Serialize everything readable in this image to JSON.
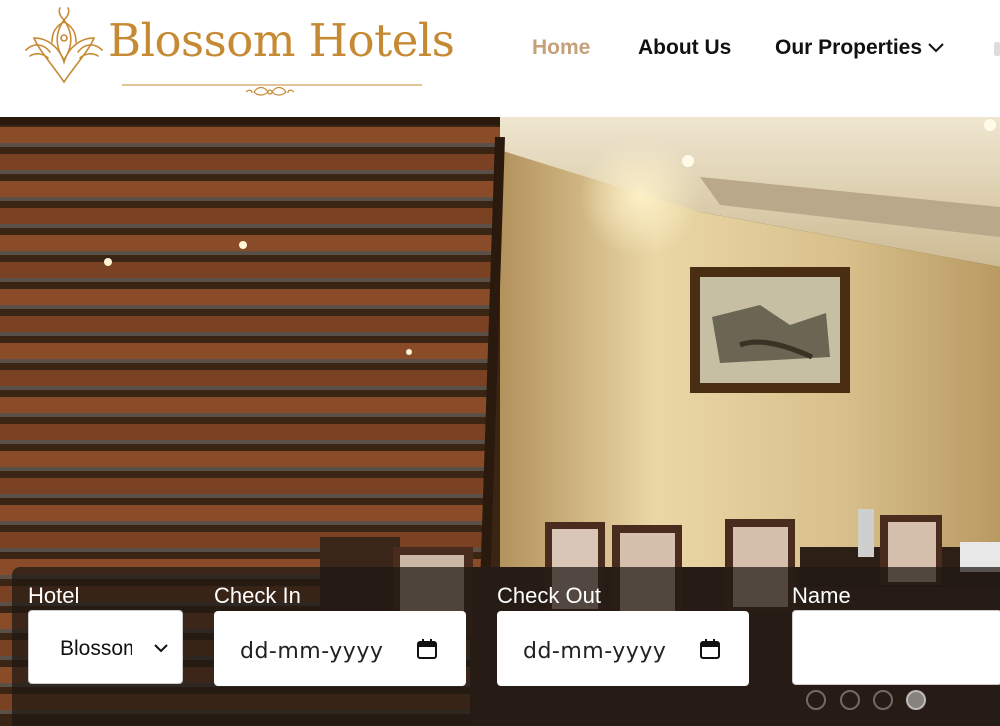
{
  "brand": {
    "name": "Blossom Hotels",
    "color": "#c78a34"
  },
  "nav": {
    "items": [
      {
        "label": "Home",
        "active": true
      },
      {
        "label": "About Us",
        "active": false
      },
      {
        "label": "Our Properties",
        "active": false,
        "icon": "chevron-down-icon"
      }
    ],
    "active_color": "#c4a178"
  },
  "booking": {
    "hotel": {
      "label": "Hotel",
      "value": "Blossom"
    },
    "check_in": {
      "label": "Check In",
      "value": "dd-mm-yyyy",
      "icon": "calendar-icon"
    },
    "check_out": {
      "label": "Check Out",
      "value": "dd-mm-yyyy",
      "icon": "calendar-icon"
    },
    "name": {
      "label": "Name",
      "value": ""
    }
  },
  "carousel": {
    "slides": 4,
    "active_index": 3
  }
}
